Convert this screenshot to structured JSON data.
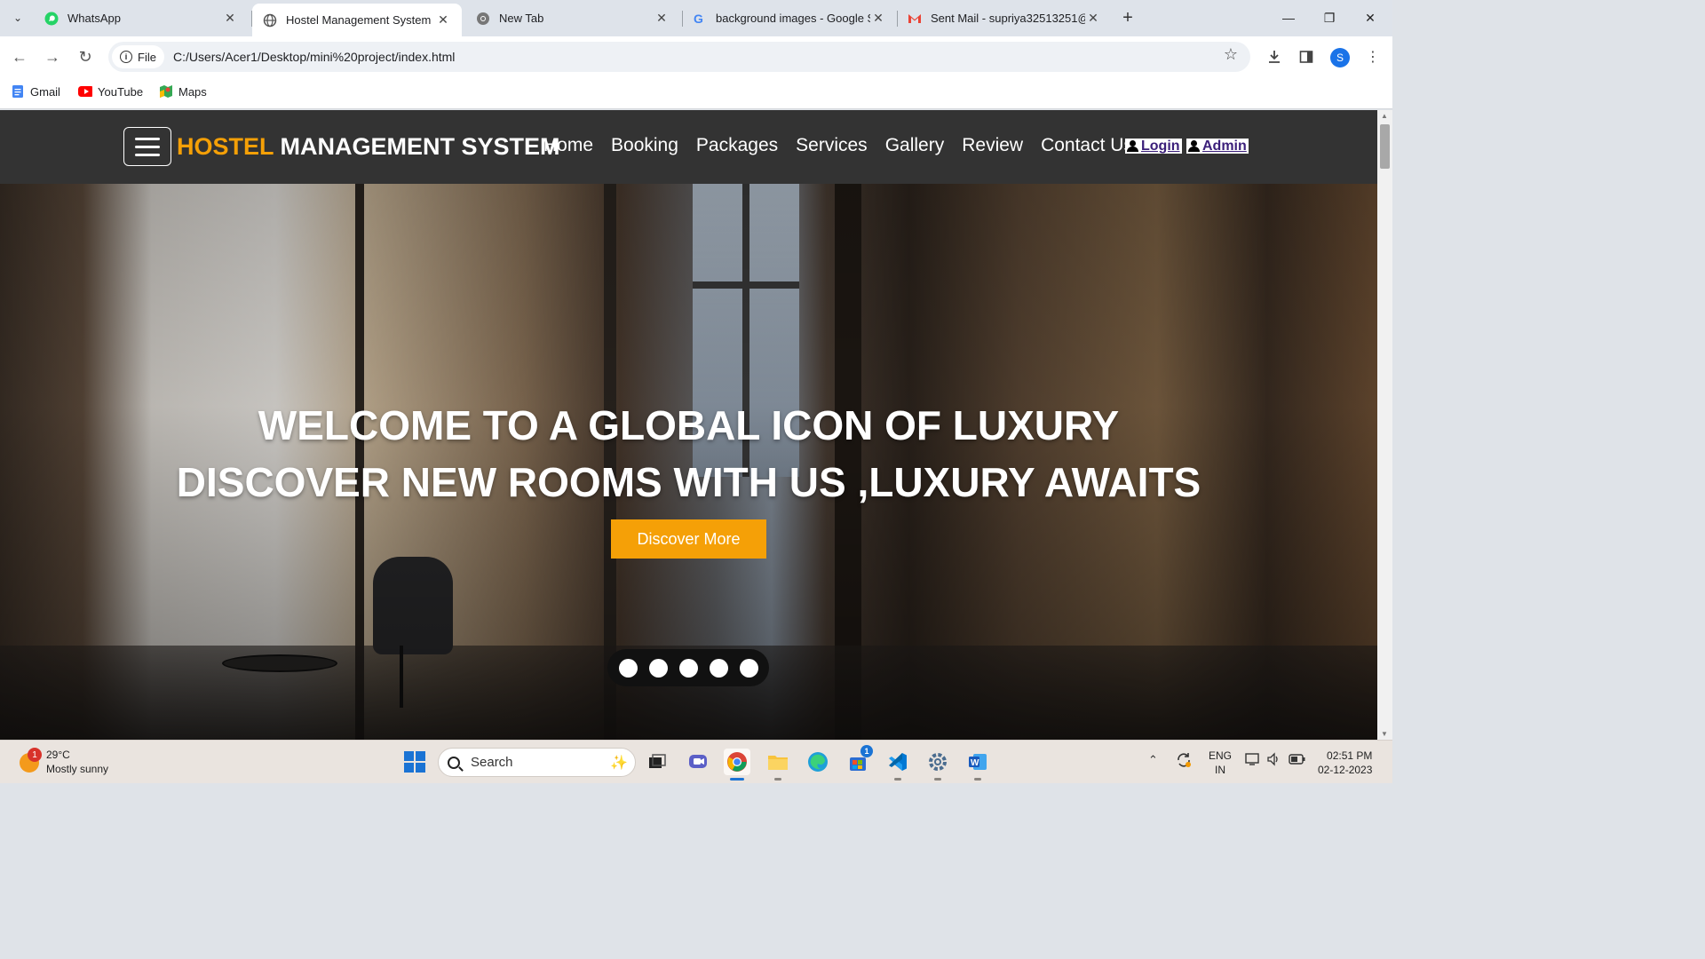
{
  "browser": {
    "tabs": [
      {
        "title": "WhatsApp",
        "icon": "whatsapp-icon"
      },
      {
        "title": "Hostel Management System",
        "icon": "globe-icon",
        "active": true
      },
      {
        "title": "New Tab",
        "icon": "chrome-icon"
      },
      {
        "title": "background images - Google S",
        "icon": "google-icon"
      },
      {
        "title": "Sent Mail - supriya32513251@",
        "icon": "gmail-icon"
      }
    ],
    "address": {
      "chip": "File",
      "url": "C:/Users/Acer1/Desktop/mini%20project/index.html"
    },
    "profile_initial": "S",
    "bookmarks": [
      {
        "label": "Gmail",
        "icon": "google-docs-icon"
      },
      {
        "label": "YouTube",
        "icon": "youtube-icon"
      },
      {
        "label": "Maps",
        "icon": "maps-icon"
      }
    ]
  },
  "site": {
    "brand_accent": "HOSTEL",
    "brand_rest": " MANAGEMENT SYSTEM",
    "menu": [
      "Home",
      "Booking",
      "Packages",
      "Services",
      "Gallery",
      "Review",
      "Contact Us"
    ],
    "login": "Login",
    "admin": "Admin",
    "hero_line1": "WELCOME TO A GLOBAL ICON OF LUXURY",
    "hero_line2": "DISCOVER NEW ROOMS WITH US ,LUXURY AWAITS",
    "cta": "Discover More",
    "slide_dots": 5,
    "colors": {
      "accent": "#f5a007",
      "nav_bg": "#333333",
      "link_text": "#3b1f7a"
    }
  },
  "taskbar": {
    "weather_temp": "29°C",
    "weather_desc": "Mostly sunny",
    "weather_badge": "1",
    "search_placeholder": "Search",
    "store_badge": "1",
    "lang_line1": "ENG",
    "lang_line2": "IN",
    "time": "02:51 PM",
    "date": "02-12-2023"
  }
}
